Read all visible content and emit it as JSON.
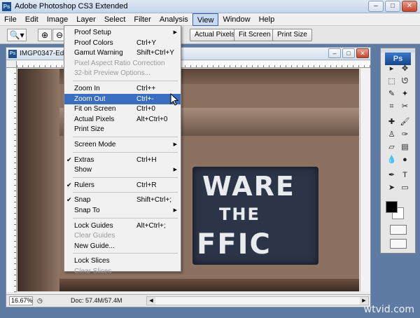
{
  "window": {
    "title": "Adobe Photoshop CS3 Extended",
    "min": "–",
    "max": "□",
    "close": "✕"
  },
  "menubar": [
    "File",
    "Edit",
    "Image",
    "Layer",
    "Select",
    "Filter",
    "Analysis",
    "View",
    "Window",
    "Help"
  ],
  "options": {
    "tool_icon": "zoom-icon",
    "zoom_in": "⊕",
    "zoom_out": "⊖",
    "buttons": [
      "Actual Pixels",
      "Fit Screen",
      "Print Size"
    ]
  },
  "document": {
    "title": "IMGP0347-Edit",
    "zoom": "16.67%",
    "doc_size": "Doc: 57.4M/57.4M",
    "sign_lines": [
      "WARE",
      "THE",
      "FFIC"
    ]
  },
  "view_menu": [
    {
      "label": "Proof Setup",
      "submenu": true
    },
    {
      "label": "Proof Colors",
      "shortcut": "Ctrl+Y"
    },
    {
      "label": "Gamut Warning",
      "shortcut": "Shift+Ctrl+Y"
    },
    {
      "label": "Pixel Aspect Ratio Correction",
      "disabled": true
    },
    {
      "label": "32-bit Preview Options...",
      "disabled": true
    },
    {
      "separator": true
    },
    {
      "label": "Zoom In",
      "shortcut": "Ctrl++"
    },
    {
      "label": "Zoom Out",
      "shortcut": "Ctrl+-",
      "highlighted": true
    },
    {
      "label": "Fit on Screen",
      "shortcut": "Ctrl+0"
    },
    {
      "label": "Actual Pixels",
      "shortcut": "Alt+Ctrl+0"
    },
    {
      "label": "Print Size"
    },
    {
      "separator": true
    },
    {
      "label": "Screen Mode",
      "submenu": true
    },
    {
      "separator": true
    },
    {
      "label": "Extras",
      "shortcut": "Ctrl+H",
      "checked": true
    },
    {
      "label": "Show",
      "submenu": true
    },
    {
      "separator": true
    },
    {
      "label": "Rulers",
      "shortcut": "Ctrl+R",
      "checked": true
    },
    {
      "separator": true
    },
    {
      "label": "Snap",
      "shortcut": "Shift+Ctrl+;",
      "checked": true
    },
    {
      "label": "Snap To",
      "submenu": true
    },
    {
      "separator": true
    },
    {
      "label": "Lock Guides",
      "shortcut": "Alt+Ctrl+;"
    },
    {
      "label": "Clear Guides",
      "disabled": true
    },
    {
      "label": "New Guide..."
    },
    {
      "separator": true
    },
    {
      "label": "Lock Slices"
    },
    {
      "label": "Clear Slices",
      "disabled": true
    }
  ],
  "toolbox": {
    "badge": "Ps"
  },
  "watermark": "wtvid.com",
  "colors": {
    "highlight": "#3a6fc0",
    "workspace": "#5e7ba3"
  }
}
